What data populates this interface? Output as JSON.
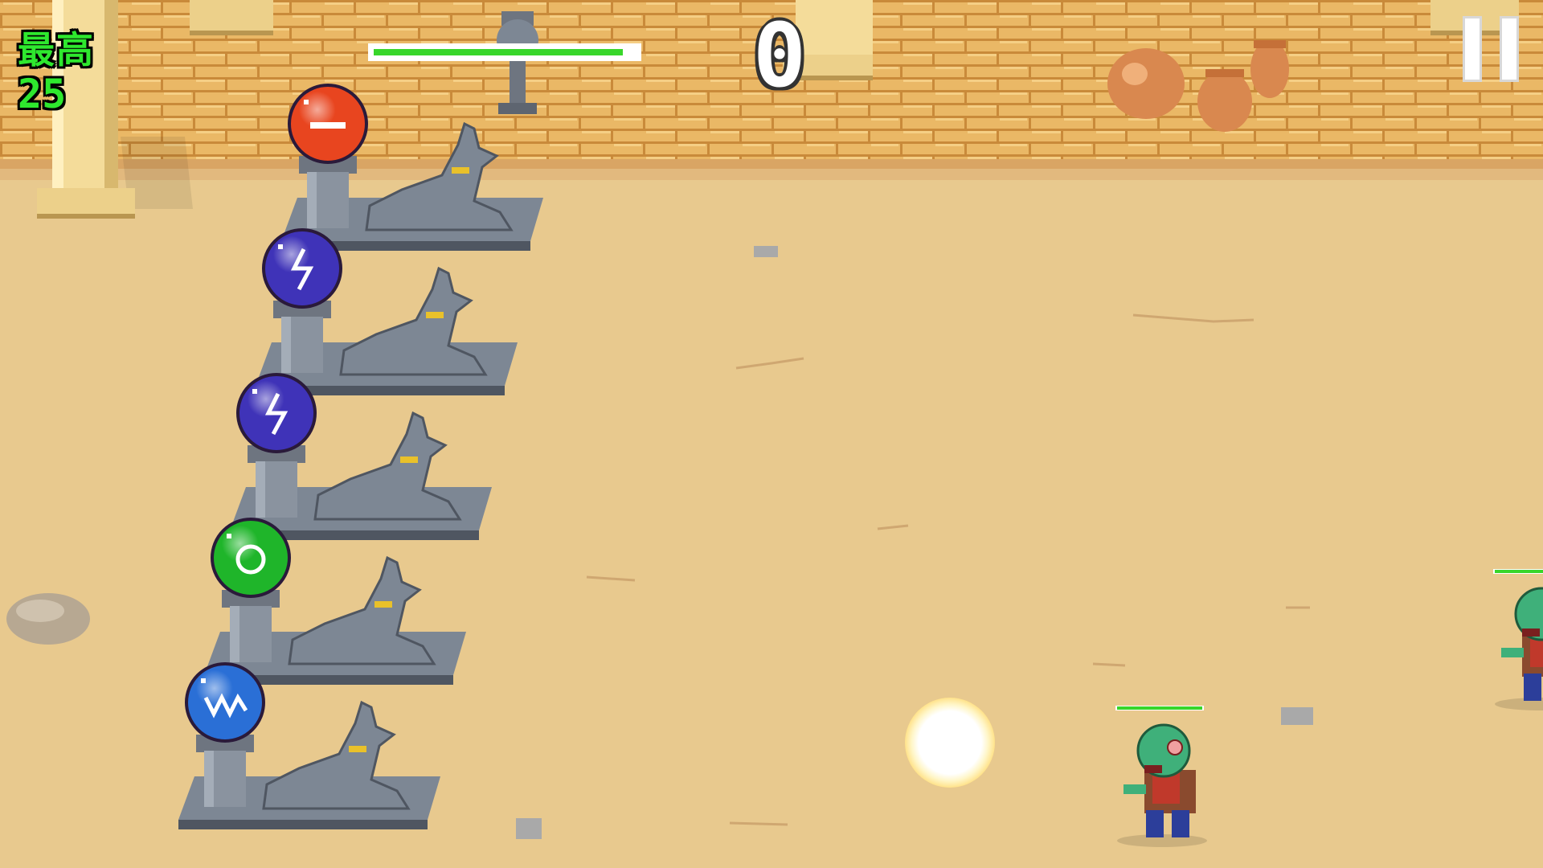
{
  "hud": {
    "best_label": "最高",
    "best_value": "25",
    "score": "0",
    "base_health_fraction": 0.95
  },
  "towers": [
    {
      "orb": "fire-orb",
      "icon": "minus-icon",
      "color": "#e8451f"
    },
    {
      "orb": "lightning-orb",
      "icon": "lightning-icon",
      "color": "#3f33b8"
    },
    {
      "orb": "lightning-orb",
      "icon": "lightning-icon",
      "color": "#3f33b8"
    },
    {
      "orb": "poison-orb",
      "icon": "ring-icon",
      "color": "#1fb52a"
    },
    {
      "orb": "ice-orb",
      "icon": "wave-icon",
      "color": "#2a6fd6"
    }
  ],
  "enemies": [
    {
      "type": "zombie",
      "health_fraction": 1.0
    },
    {
      "type": "zombie",
      "health_fraction": 1.0
    }
  ],
  "colors": {
    "sand": "#e8c98e",
    "wall_brick": "#e9b866",
    "stone": "#7d8794",
    "hud_green": "#2ee82e",
    "health_green": "#38d62a"
  }
}
